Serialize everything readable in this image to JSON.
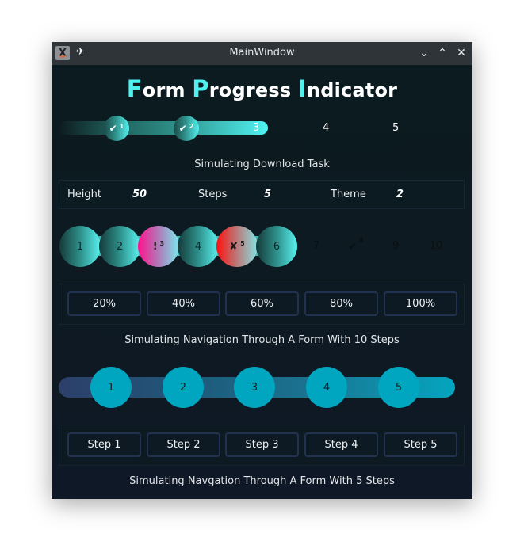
{
  "window": {
    "title": "MainWindow",
    "icons": {
      "app": "x-app-icon",
      "pin": "pin-icon",
      "minimize": "chevron-down-icon",
      "maximize": "chevron-up-icon",
      "close": "close-icon"
    },
    "glyphs": {
      "app": "X",
      "pin": "✈",
      "minimize": "⌄",
      "maximize": "⌃",
      "close": "✕"
    }
  },
  "header": {
    "title_parts": [
      {
        "initial": "F",
        "rest": "orm "
      },
      {
        "initial": "P",
        "rest": "rogress "
      },
      {
        "initial": "I",
        "rest": "ndicator"
      }
    ],
    "accent_color": "#4ff0f0"
  },
  "progress_download": {
    "steps_total": 5,
    "current_step": 3,
    "nodes": [
      {
        "step": "1",
        "state": "done",
        "glyph": "✔"
      },
      {
        "step": "2",
        "state": "done",
        "glyph": "✔"
      },
      {
        "step": "3",
        "state": "current"
      },
      {
        "step": "4",
        "state": "pending"
      },
      {
        "step": "5",
        "state": "pending"
      }
    ],
    "caption": "Simulating Download Task"
  },
  "settings": {
    "height_label": "Height",
    "height_value": "50",
    "steps_label": "Steps",
    "steps_value": "5",
    "theme_label": "Theme",
    "theme_value": "2"
  },
  "progress_ten": {
    "steps_total": 10,
    "current_step": 6,
    "nodes": [
      {
        "step": "1",
        "state": "done"
      },
      {
        "step": "2",
        "state": "done"
      },
      {
        "step": "3",
        "state": "warning",
        "glyph": "!"
      },
      {
        "step": "4",
        "state": "done"
      },
      {
        "step": "5",
        "state": "error",
        "glyph": "✘"
      },
      {
        "step": "6",
        "state": "current"
      },
      {
        "step": "7",
        "state": "pending"
      },
      {
        "step": "8",
        "state": "pending-done",
        "glyph": "✔"
      },
      {
        "step": "9",
        "state": "pending"
      },
      {
        "step": "10",
        "state": "pending"
      }
    ],
    "buttons": [
      "20%",
      "40%",
      "60%",
      "80%",
      "100%"
    ],
    "caption": "Simulating Navigation Through A Form With 10 Steps"
  },
  "progress_five": {
    "steps_total": 5,
    "current_step": 5,
    "nodes": [
      "1",
      "2",
      "3",
      "4",
      "5"
    ],
    "buttons": [
      "Step 1",
      "Step 2",
      "Step 3",
      "Step 4",
      "Step 5"
    ],
    "caption": "Simulating Navgation Through A Form With 5 Steps"
  }
}
